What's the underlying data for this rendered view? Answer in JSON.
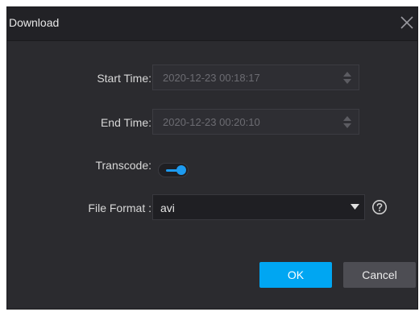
{
  "dialog": {
    "title": "Download",
    "close_icon": "close-icon"
  },
  "fields": {
    "start_time_label": "Start Time:",
    "start_time_value": "2020-12-23 00:18:17",
    "end_time_label": "End Time:",
    "end_time_value": "2020-12-23 00:20:10",
    "transcode_label": "Transcode:",
    "transcode_enabled": true,
    "file_format_label": "File Format :",
    "file_format_value": "avi"
  },
  "buttons": {
    "ok_label": "OK",
    "cancel_label": "Cancel"
  },
  "icons": {
    "spinner": "spinner-arrows-icon",
    "caret": "chevron-down-icon",
    "help": "help-icon"
  },
  "colors": {
    "accent": "#00a6f2",
    "toggle_on": "#1d9bf0",
    "dialog_bg": "#2b2b2f"
  }
}
